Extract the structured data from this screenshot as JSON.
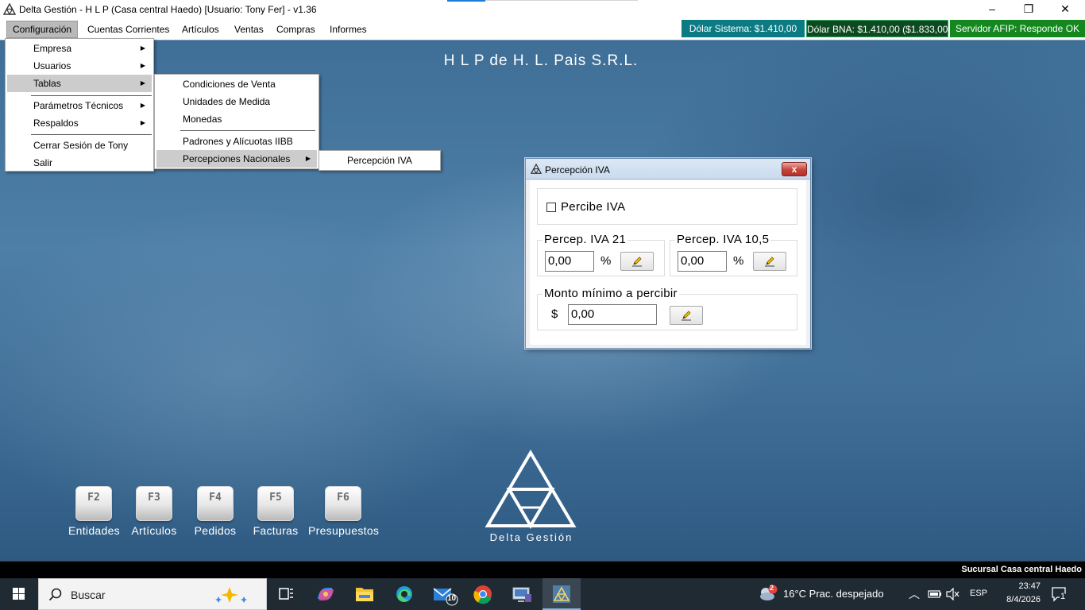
{
  "window": {
    "title": "Delta Gestión - H L P (Casa central Haedo) [Usuario: Tony Fer] - v1.36",
    "minimize_glyph": "–",
    "restore_glyph": "❐",
    "close_glyph": "✕"
  },
  "menubar": {
    "items": [
      "Configuración",
      "Cuentas Corrientes",
      "Artículos",
      "Ventas",
      "Compras",
      "Informes"
    ]
  },
  "status": {
    "dolar_sistema": "Dólar Sistema: $1.410,00",
    "dolar_bna": "Dólar BNA: $1.410,00 ($1.833,00)",
    "servidor_afip": "Servidor AFIP:  Responde OK",
    "colors": {
      "dolar_sistema": "#0b7a83",
      "dolar_bna": "#0d4a1f",
      "servidor_afip": "#14881e"
    }
  },
  "company_name": "H L P de H. L. Pais S.R.L.",
  "config_menu": {
    "items": [
      "Empresa",
      "Usuarios",
      "Tablas",
      "Parámetros Técnicos",
      "Respaldos",
      "Cerrar Sesión de Tony",
      "Salir"
    ],
    "highlighted": "Tablas"
  },
  "tablas_menu": {
    "items": [
      "Condiciones de Venta",
      "Unidades de Medida",
      "Monedas",
      "Padrones y Alícuotas IIBB",
      "Percepciones Nacionales"
    ],
    "highlighted": "Percepciones Nacionales"
  },
  "percepciones_menu": {
    "items": [
      "Percepción IVA"
    ]
  },
  "dialog": {
    "title": "Percepción IVA",
    "close_label": "x",
    "percibe_iva_label": "Percibe IVA",
    "percibe_iva_checked": false,
    "perc21_legend": "Percep. IVA 21",
    "perc21_value": "0,00",
    "perc105_legend": "Percep. IVA 10,5",
    "perc105_value": "0,00",
    "percent_symbol": "%",
    "monto_legend": "Monto mínimo a percibir",
    "currency_symbol": "$",
    "monto_value": "0,00"
  },
  "shortcuts": [
    {
      "key": "F2",
      "label": "Entidades"
    },
    {
      "key": "F3",
      "label": "Artículos"
    },
    {
      "key": "F4",
      "label": "Pedidos"
    },
    {
      "key": "F5",
      "label": "Facturas"
    },
    {
      "key": "F6",
      "label": "Presupuestos"
    }
  ],
  "logo_text": "Delta Gestión",
  "branch": "Sucursal Casa central Haedo",
  "taskbar": {
    "search_placeholder": "Buscar",
    "mail_badge": "10",
    "weather_badge": "2",
    "weather": "16°C  Prac. despejado",
    "language": "ESP",
    "time": "23:47",
    "date": "8/4/2026",
    "notifications": "1"
  }
}
